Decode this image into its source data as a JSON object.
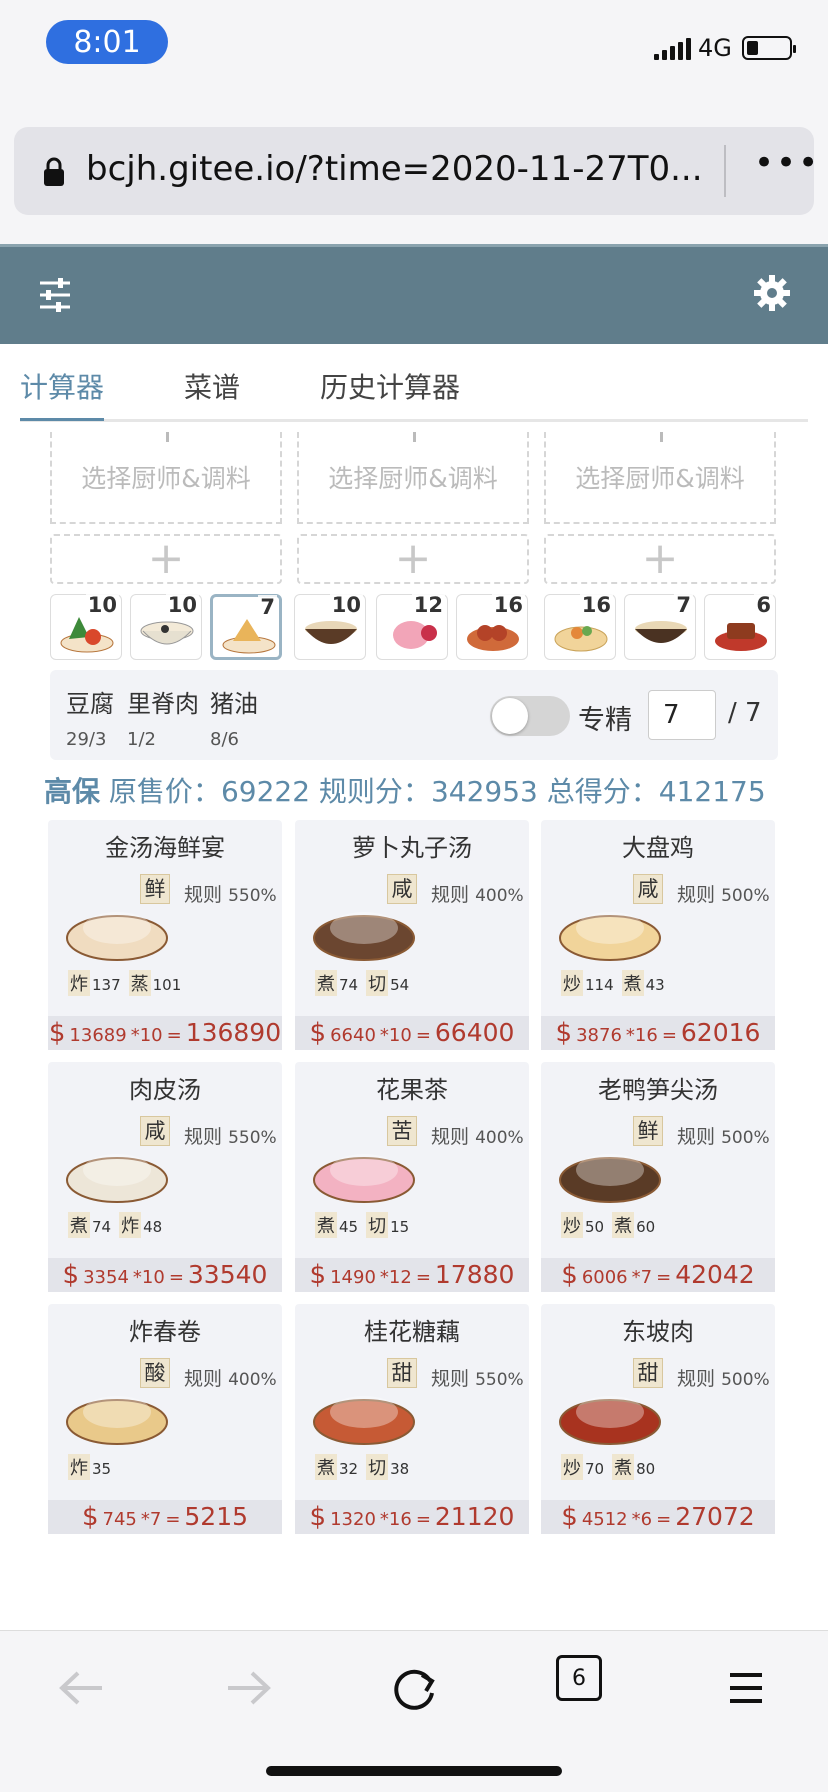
{
  "status": {
    "time": "8:01",
    "network": "4G"
  },
  "browser": {
    "url": "bcjh.gitee.io/?time=2020-11-27T0...",
    "more": "•••",
    "tab_count": "6"
  },
  "tabs": [
    {
      "label": "计算器",
      "active": true
    },
    {
      "label": "菜谱",
      "active": false
    },
    {
      "label": "历史计算器",
      "active": false
    }
  ],
  "chef_slots": [
    "选择厨师&调料",
    "选择厨师&调料",
    "选择厨师&调料"
  ],
  "add_symbol": "+",
  "recipe_counts": [
    "10",
    "10",
    "7",
    "10",
    "12",
    "16",
    "16",
    "7",
    "6"
  ],
  "ingredients": [
    {
      "name": "豆腐",
      "qty": "29/3"
    },
    {
      "name": "里脊肉",
      "qty": "1/2"
    },
    {
      "name": "猪油",
      "qty": "8/6"
    }
  ],
  "specialty": {
    "label": "专精",
    "value": "7",
    "total": "/ 7"
  },
  "score": {
    "level": "高保",
    "original_label": "原售价：",
    "original": "69222",
    "rule_label": "规则分：",
    "rule": "342953",
    "total_label": "总得分：",
    "total": "412175"
  },
  "dishes": [
    {
      "name": "金汤海鲜宴",
      "flavor": "鲜",
      "rule": "规则",
      "pct": "550%",
      "skills": [
        {
          "tag": "炸",
          "val": "137"
        },
        {
          "tag": "蒸",
          "val": "101"
        }
      ],
      "price": "13689",
      "mult": "*10",
      "total": "136890"
    },
    {
      "name": "萝卜丸子汤",
      "flavor": "咸",
      "rule": "规则",
      "pct": "400%",
      "skills": [
        {
          "tag": "煮",
          "val": "74"
        },
        {
          "tag": "切",
          "val": "54"
        }
      ],
      "price": "6640",
      "mult": "*10",
      "total": "66400"
    },
    {
      "name": "大盘鸡",
      "flavor": "咸",
      "rule": "规则",
      "pct": "500%",
      "skills": [
        {
          "tag": "炒",
          "val": "114"
        },
        {
          "tag": "煮",
          "val": "43"
        }
      ],
      "price": "3876",
      "mult": "*16",
      "total": "62016"
    },
    {
      "name": "肉皮汤",
      "flavor": "咸",
      "rule": "规则",
      "pct": "550%",
      "skills": [
        {
          "tag": "煮",
          "val": "74"
        },
        {
          "tag": "炸",
          "val": "48"
        }
      ],
      "price": "3354",
      "mult": "*10",
      "total": "33540"
    },
    {
      "name": "花果茶",
      "flavor": "苦",
      "rule": "规则",
      "pct": "400%",
      "skills": [
        {
          "tag": "煮",
          "val": "45"
        },
        {
          "tag": "切",
          "val": "15"
        }
      ],
      "price": "1490",
      "mult": "*12",
      "total": "17880"
    },
    {
      "name": "老鸭笋尖汤",
      "flavor": "鲜",
      "rule": "规则",
      "pct": "500%",
      "skills": [
        {
          "tag": "炒",
          "val": "50"
        },
        {
          "tag": "煮",
          "val": "60"
        }
      ],
      "price": "6006",
      "mult": "*7",
      "total": "42042"
    },
    {
      "name": "炸春卷",
      "flavor": "酸",
      "rule": "规则",
      "pct": "400%",
      "skills": [
        {
          "tag": "炸",
          "val": "35"
        }
      ],
      "price": "745",
      "mult": "*7",
      "total": "5215"
    },
    {
      "name": "桂花糖藕",
      "flavor": "甜",
      "rule": "规则",
      "pct": "550%",
      "skills": [
        {
          "tag": "煮",
          "val": "32"
        },
        {
          "tag": "切",
          "val": "38"
        }
      ],
      "price": "1320",
      "mult": "*16",
      "total": "21120"
    },
    {
      "name": "东坡肉",
      "flavor": "甜",
      "rule": "规则",
      "pct": "500%",
      "skills": [
        {
          "tag": "炒",
          "val": "70"
        },
        {
          "tag": "煮",
          "val": "80"
        }
      ],
      "price": "4512",
      "mult": "*6",
      "total": "27072"
    }
  ],
  "currency": "$",
  "equals": "=",
  "colors": {
    "header": "#607d8b",
    "accent": "#5d8aa8",
    "price": "#b03a2e",
    "status_pill": "#2f6fe0"
  }
}
